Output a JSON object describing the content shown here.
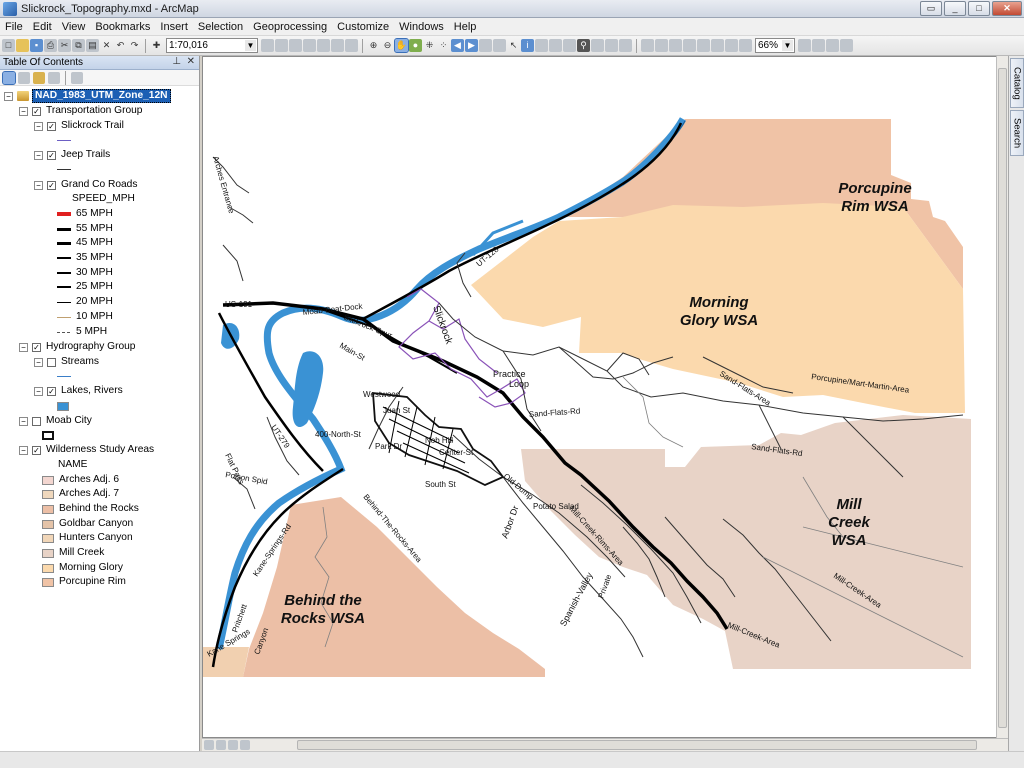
{
  "window": {
    "title": "Slickrock_Topography.mxd - ArcMap"
  },
  "menu": [
    "File",
    "Edit",
    "View",
    "Bookmarks",
    "Insert",
    "Selection",
    "Geoprocessing",
    "Customize",
    "Windows",
    "Help"
  ],
  "toolbar": {
    "scale": "1:70,016",
    "zoom": "66%"
  },
  "toc": {
    "title": "Table Of Contents",
    "data_frame": "NAD_1983_UTM_Zone_12N",
    "transportation_group": "Transportation Group",
    "slickrock_trail": "Slickrock Trail",
    "jeep_trails": "Jeep Trails",
    "grand_co_roads": "Grand Co Roads",
    "speed_field": "SPEED_MPH",
    "speeds": [
      "65 MPH",
      "55 MPH",
      "45 MPH",
      "35 MPH",
      "30 MPH",
      "25 MPH",
      "20 MPH",
      "10 MPH",
      "5 MPH"
    ],
    "hydrography_group": "Hydrography Group",
    "streams": "Streams",
    "lakes_rivers": "Lakes, Rivers",
    "moab_city": "Moab City",
    "wsa": "Wilderness Study Areas",
    "name_field": "NAME",
    "wsa_items": [
      "Arches Adj. 6",
      "Arches Adj. 7",
      "Behind the Rocks",
      "Goldbar Canyon",
      "Hunters Canyon",
      "Mill Creek",
      "Morning Glory",
      "Porcupine Rim"
    ]
  },
  "side_tabs": {
    "catalog": "Catalog",
    "search": "Search"
  },
  "map": {
    "wsa_labels": {
      "porcupine": [
        "Porcupine",
        "Rim WSA"
      ],
      "morning": [
        "Morning",
        "Glory WSA"
      ],
      "mill": [
        "Mill",
        "Creek",
        "WSA"
      ],
      "behind": [
        "Behind the",
        "Rocks WSA"
      ]
    },
    "road_labels": {
      "sand_flats_rd": "Sand-Flats-Rd",
      "sand_flats_area": "Sand-Flats-Area",
      "sand_flats_rd2": "Sand-Flats-Rd",
      "porcupine_mart": "Porcupine/Mart-Martin-Area",
      "mill_creek_area": "Mill-Creek-Area",
      "mill_creek_area2": "Mill-Creek-Area",
      "mill_creek_rims": "Mill-Creek-Rims-Area",
      "practice": "Practice",
      "loop": "Loop",
      "slickrock_spur": "Slickrock-Spur",
      "slickrock": "Slickrock",
      "us191": "US-191",
      "ut128": "UT-128",
      "ut279": "UT-279",
      "kane_springs": "Kane-Springs-Rd",
      "main_st": "Main-St",
      "north_400": "400-North-St",
      "nob_hill": "Nob Hill",
      "center_st": "Center-St",
      "south_st": "South St",
      "old_dump": "Old Dump",
      "potato_salad": "Potato Salad",
      "arbor_dr": "Arbor Dr",
      "spanish_valley": "Spanish-Valley",
      "private": "Private",
      "behind_rocks_area": "Behind-The-Rocks-Area",
      "poison_spider": "Poison Spid",
      "pritchett": "Pritchett",
      "canyon": "Canyon",
      "kane_springs2": "Kane Springs",
      "westwood": "Westwood",
      "park_dr": "Park Dr",
      "juan_st": "Juan St",
      "flat_pass": "Flat Pass",
      "arches_entrance": "Arches Entrance",
      "moab_boat_dock": "Moab-Boat-Dock"
    }
  },
  "colors": {
    "porcupine_rim": "#f0c3a6",
    "morning_glory": "#fbd9ad",
    "mill_creek": "#e8d3c7",
    "behind_the_rocks": "#ecbfa6",
    "river": "#3a92d4",
    "trail_purple": "#8a52b8",
    "road_65": "#e02020"
  }
}
